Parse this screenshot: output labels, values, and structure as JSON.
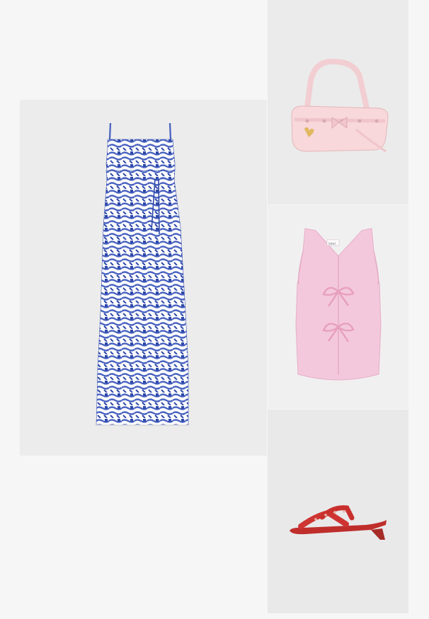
{
  "outfit": {
    "items": [
      {
        "name": "Blue printed maxi dress",
        "colors": {
          "primary": "#4a63c0",
          "secondary": "#ffffff"
        }
      },
      {
        "name": "Light pink shoulder bag",
        "colors": {
          "primary": "#f6d4d6"
        }
      },
      {
        "name": "Pink tie-front vest top",
        "colors": {
          "primary": "#f4c9dc"
        }
      },
      {
        "name": "Red heeled mule sandal",
        "colors": {
          "primary": "#c8312f"
        }
      }
    ]
  },
  "tag_label": "label"
}
